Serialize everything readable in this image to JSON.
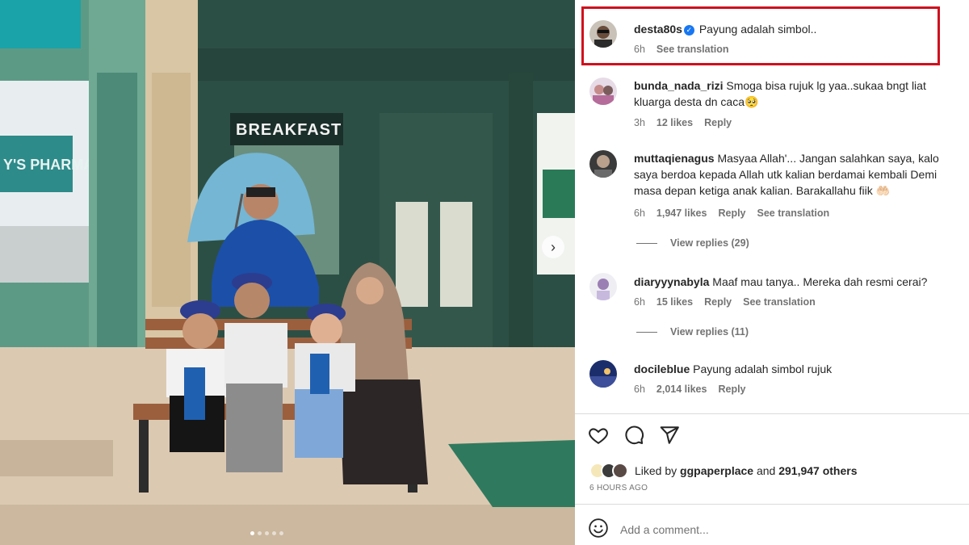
{
  "photo": {
    "sign_text": "BREAKFAST",
    "pharmacy_text": "Y'S PHARMACY",
    "carousel_dots": 5,
    "active_dot": 0
  },
  "caption": {
    "username": "desta80s",
    "text": "Payung adalah simbol..",
    "time": "6h",
    "translate": "See translation"
  },
  "comments": [
    {
      "username": "bunda_nada_rizi",
      "text": "Smoga bisa rujuk lg yaa..sukaa bngt liat kluarga desta dn caca🥺",
      "time": "3h",
      "likes": "12 likes",
      "reply": "Reply",
      "translate": ""
    },
    {
      "username": "muttaqienagus",
      "text": "Masyaa Allah'... Jangan salahkan saya, kalo saya berdoa kepada Allah utk kalian berdamai kembali Demi masa depan ketiga anak kalian. Barakallahu fiik 🤲🏻",
      "time": "6h",
      "likes": "1,947 likes",
      "reply": "Reply",
      "translate": "See translation",
      "view_replies": "View replies (29)"
    },
    {
      "username": "diaryyynabyla",
      "text": "Maaf mau tanya.. Mereka dah resmi cerai?",
      "time": "6h",
      "likes": "15 likes",
      "reply": "Reply",
      "translate": "See translation",
      "view_replies": "View replies (11)"
    },
    {
      "username": "docileblue",
      "text": "Payung adalah simbol rujuk",
      "time": "6h",
      "likes": "2,014 likes",
      "reply": "Reply",
      "translate": ""
    }
  ],
  "actions": {
    "like_icon": "heart-icon",
    "comment_icon": "comment-icon",
    "share_icon": "share-icon"
  },
  "likes": {
    "prefix": "Liked by ",
    "user": "ggpaperplace",
    "middle": " and ",
    "count": "291,947 others"
  },
  "timestamp": "6 HOURS AGO",
  "add_comment": {
    "placeholder": "Add a comment...",
    "emoji_icon": "emoji-icon"
  },
  "colors": {
    "highlight": "#d0101e",
    "verified": "#1877f2",
    "muted": "#737373"
  }
}
